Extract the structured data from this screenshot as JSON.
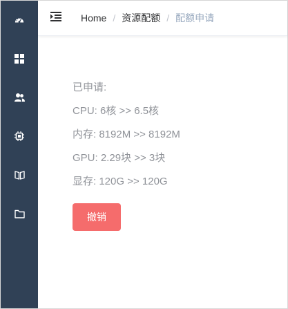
{
  "sidebar": {
    "items": [
      {
        "icon": "dashboard-icon"
      },
      {
        "icon": "grid-icon"
      },
      {
        "icon": "users-icon"
      },
      {
        "icon": "chip-icon"
      },
      {
        "icon": "book-icon"
      },
      {
        "icon": "folder-icon"
      }
    ]
  },
  "header": {
    "breadcrumb": {
      "home": "Home",
      "section": "资源配额",
      "current": "配额申请",
      "separator": "/"
    }
  },
  "content": {
    "applied_label": "已申请:",
    "cpu": "CPU: 6核 >> 6.5核",
    "memory": "内存: 8192M >> 8192M",
    "gpu": "GPU: 2.29块 >> 3块",
    "vram": "显存: 120G >> 120G",
    "cancel_label": "撤销"
  },
  "colors": {
    "sidebar_bg": "#304156",
    "danger": "#f56c6c",
    "text_muted": "#909399",
    "breadcrumb_current": "#97a8be"
  }
}
